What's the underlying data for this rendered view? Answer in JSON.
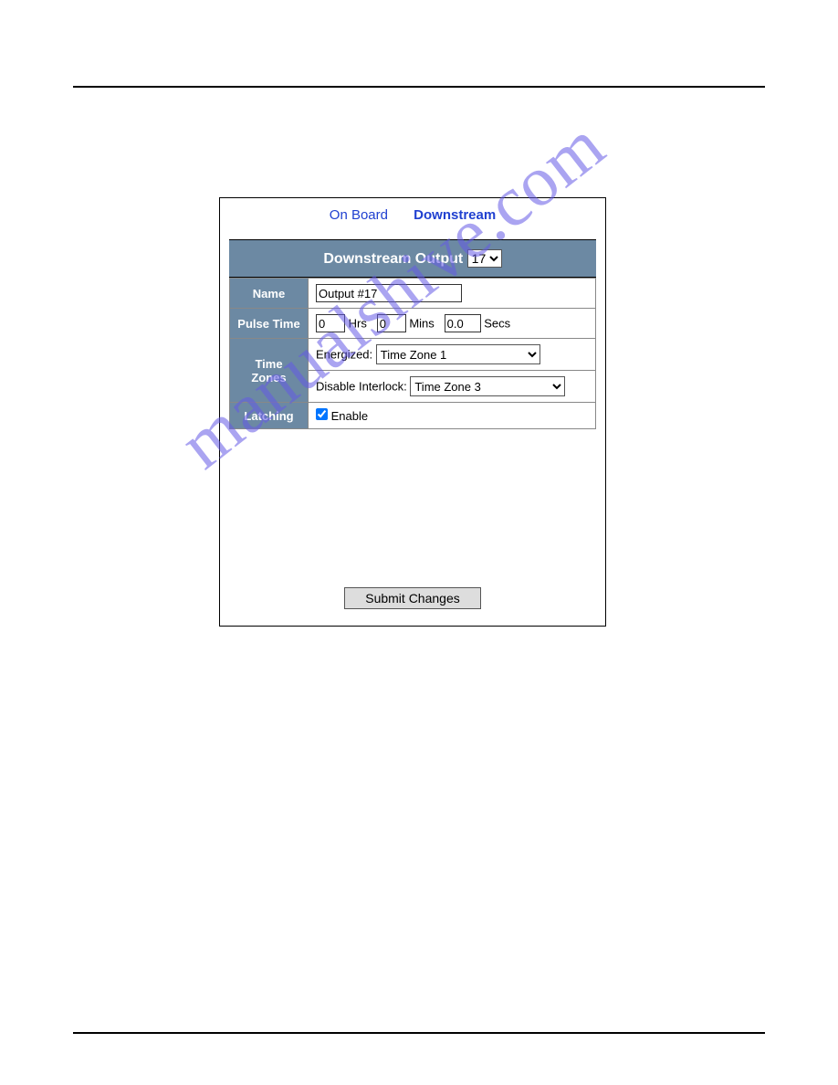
{
  "tabs": {
    "onboard": "On Board",
    "downstream": "Downstream"
  },
  "header": {
    "title": "Downstream Output",
    "selected_output": "17"
  },
  "fields": {
    "name_label": "Name",
    "name_value": "Output #17",
    "pulse_label": "Pulse Time",
    "pulse_hrs": "0",
    "pulse_hrs_unit": "Hrs",
    "pulse_mins": "0",
    "pulse_mins_unit": "Mins",
    "pulse_secs": "0.0",
    "pulse_secs_unit": "Secs",
    "tz_label": "Time Zones",
    "energized_label": "Energized:",
    "energized_value": "Time Zone 1",
    "disable_label": "Disable Interlock:",
    "disable_value": "Time Zone 3",
    "latching_label": "Latching",
    "latching_enable": "Enable"
  },
  "submit_label": "Submit Changes",
  "watermark": "manualshive.com"
}
